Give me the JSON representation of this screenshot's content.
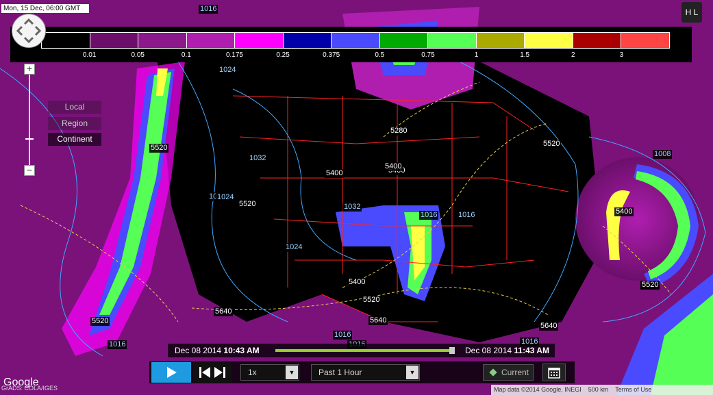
{
  "header": {
    "valid_time": "Mon, 15 Dec, 06:00 GMT"
  },
  "legend": {
    "labels": [
      "0.01",
      "0.05",
      "0.1",
      "0.175",
      "0.25",
      "0.375",
      "0.5",
      "0.75",
      "1",
      "1.5",
      "2",
      "3"
    ],
    "colors": [
      "#000000",
      "#6b0f6b",
      "#8b198b",
      "#b01eb0",
      "#ff00ff",
      "#0000aa",
      "#4a4aff",
      "#00aa00",
      "#55ff55",
      "#aaaa00",
      "#ffff44",
      "#aa0000",
      "#ff4444"
    ]
  },
  "toggle": {
    "label": "H L"
  },
  "scope": {
    "local": "Local",
    "region": "Region",
    "continent": "Continent"
  },
  "contours": {
    "thickness": [
      "5520",
      "5520",
      "5400",
      "5280",
      "5400",
      "5520",
      "5520",
      "5400",
      "5400",
      "5520",
      "5520",
      "5640",
      "5640",
      "5640",
      "5520",
      "5400",
      "5520"
    ],
    "pressure": [
      "1016",
      "1024",
      "1032",
      "1024",
      "1032",
      "1024",
      "1024",
      "1032",
      "1016",
      "1016",
      "1008",
      "1016",
      "1016",
      "1016",
      "1016"
    ]
  },
  "timebar": {
    "start_date": "Dec 08 2014 ",
    "start_time": "10:43 AM",
    "end_date": "Dec 08 2014 ",
    "end_time": "11:43 AM"
  },
  "controls": {
    "speed": "1x",
    "range": "Past 1 Hour",
    "current": "Current"
  },
  "footer": {
    "google": "Google",
    "credit": "GrADS: COLA/IGES",
    "map_data": "Map data ©2014 Google, INEGI",
    "scale": "500 km",
    "terms": "Terms of Use"
  }
}
